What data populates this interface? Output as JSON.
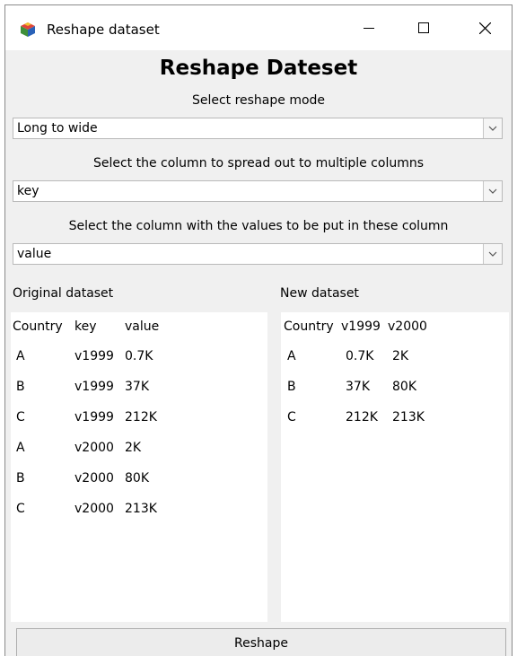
{
  "window": {
    "title": "Reshape dataset"
  },
  "heading": "Reshape Dateset",
  "mode": {
    "label": "Select reshape mode",
    "value": "Long to wide"
  },
  "spread": {
    "label": "Select the column to spread out to multiple columns",
    "value": "key"
  },
  "values_col": {
    "label": "Select the column with the values to be put in these column",
    "value": "value"
  },
  "original": {
    "label": "Original dataset",
    "headers": [
      "Country",
      "key",
      "value"
    ],
    "rows": [
      [
        "A",
        "v1999",
        "0.7K"
      ],
      [
        "B",
        "v1999",
        "37K"
      ],
      [
        "C",
        "v1999",
        "212K"
      ],
      [
        "A",
        "v2000",
        "2K"
      ],
      [
        "B",
        "v2000",
        "80K"
      ],
      [
        "C",
        "v2000",
        "213K"
      ]
    ]
  },
  "result": {
    "label": "New dataset",
    "headers": [
      "Country",
      "v1999",
      "v2000"
    ],
    "rows": [
      [
        "A",
        "0.7K",
        "2K"
      ],
      [
        "B",
        "37K",
        "80K"
      ],
      [
        "C",
        "212K",
        "213K"
      ]
    ]
  },
  "reshape_button": "Reshape",
  "icons": {
    "app": "cube-icon",
    "minimize": "minimize-icon",
    "maximize": "maximize-icon",
    "close": "close-icon",
    "dropdown": "chevron-down-icon"
  }
}
